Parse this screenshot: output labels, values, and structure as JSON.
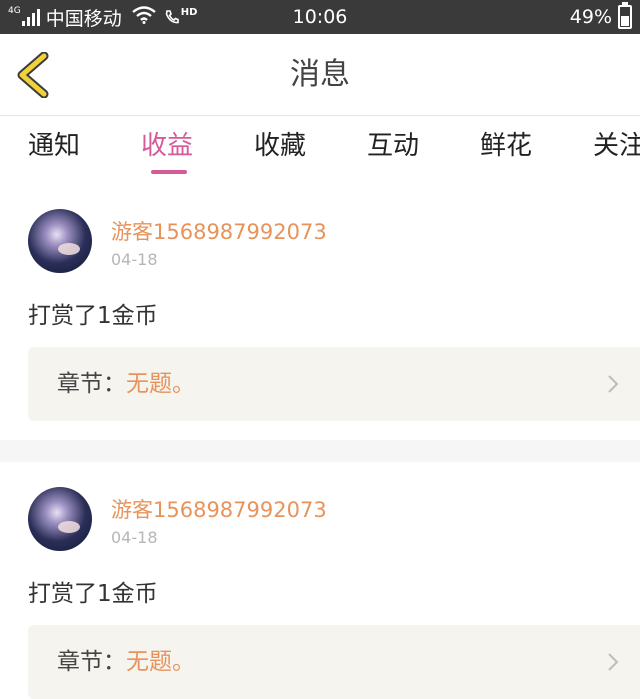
{
  "status_bar": {
    "network": "4G",
    "carrier": "中国移动",
    "hd": "HD",
    "time": "10:06",
    "battery": "49%",
    "battery_level": 0.49
  },
  "nav": {
    "title": "消息",
    "back_icon": "chevron-left-icon"
  },
  "tabs": [
    {
      "label": "通知"
    },
    {
      "label": "收益"
    },
    {
      "label": "收藏"
    },
    {
      "label": "互动"
    },
    {
      "label": "鲜花"
    },
    {
      "label": "关注"
    }
  ],
  "active_tab": "收益",
  "messages": [
    {
      "username": "游客1568987992073",
      "date": "04-18",
      "text": "打赏了1金币",
      "chapter_label": "章节：",
      "chapter_title": "无题。"
    },
    {
      "username": "游客1568987992073",
      "date": "04-18",
      "text": "打赏了1金币",
      "chapter_label": "章节：",
      "chapter_title": "无题。"
    }
  ],
  "colors": {
    "accent": "#d65a9a",
    "username": "#e8935b",
    "back_icon": "#f2d13a",
    "status_bar": "#3a3a3a"
  }
}
